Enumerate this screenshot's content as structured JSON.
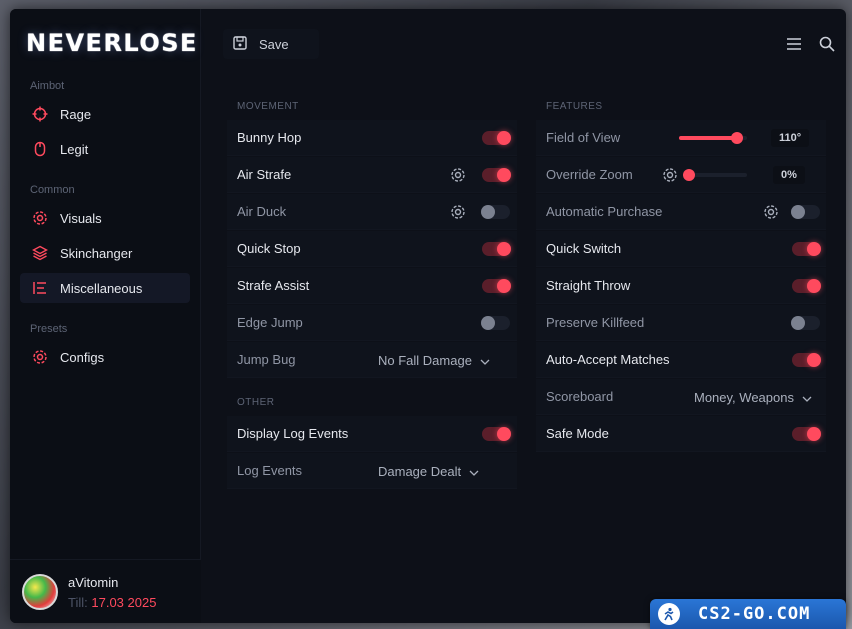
{
  "app": {
    "logo": "NEVERLOSE"
  },
  "sidebar": {
    "sections": [
      {
        "label": "Aimbot",
        "items": [
          {
            "label": "Rage",
            "icon": "crosshair-icon"
          },
          {
            "label": "Legit",
            "icon": "mouse-icon"
          }
        ]
      },
      {
        "label": "Common",
        "items": [
          {
            "label": "Visuals",
            "icon": "gear-icon"
          },
          {
            "label": "Skinchanger",
            "icon": "layers-icon"
          },
          {
            "label": "Miscellaneous",
            "icon": "list-icon"
          }
        ]
      },
      {
        "label": "Presets",
        "items": [
          {
            "label": "Configs",
            "icon": "gear-icon"
          }
        ]
      }
    ],
    "active_item": "Miscellaneous"
  },
  "user": {
    "name": "aVitomin",
    "till_label": "Till:",
    "till_date": "17.03 2025"
  },
  "toolbar": {
    "save_label": "Save"
  },
  "movement": {
    "title": "MOVEMENT",
    "rows": [
      {
        "label": "Bunny Hop",
        "enabled": true
      },
      {
        "label": "Air Strafe",
        "enabled": true,
        "settings": true
      },
      {
        "label": "Air Duck",
        "enabled": false,
        "settings": true
      },
      {
        "label": "Quick Stop",
        "enabled": true
      },
      {
        "label": "Strafe Assist",
        "enabled": true
      },
      {
        "label": "Edge Jump",
        "enabled": false
      },
      {
        "label": "Jump Bug",
        "dropdown": "No Fall Damage"
      }
    ]
  },
  "other": {
    "title": "OTHER",
    "rows": [
      {
        "label": "Display Log Events",
        "enabled": true
      },
      {
        "label": "Log Events",
        "dropdown": "Damage Dealt"
      }
    ]
  },
  "features": {
    "title": "FEATURES",
    "rows": [
      {
        "label": "Field of View",
        "slider": 0.85,
        "value": "110°"
      },
      {
        "label": "Override Zoom",
        "slider": 0.0,
        "value": "0%",
        "settings": true
      },
      {
        "label": "Automatic Purchase",
        "enabled": false,
        "settings": true
      },
      {
        "label": "Quick Switch",
        "enabled": true
      },
      {
        "label": "Straight Throw",
        "enabled": true
      },
      {
        "label": "Preserve Killfeed",
        "enabled": false
      },
      {
        "label": "Auto-Accept Matches",
        "enabled": true
      },
      {
        "label": "Scoreboard",
        "dropdown": "Money, Weapons"
      },
      {
        "label": "Safe Mode",
        "enabled": true
      }
    ]
  },
  "watermark": {
    "text": "CS2-GO.COM"
  },
  "colors": {
    "accent": "#ff4a5e",
    "background": "#0d1018",
    "panel": "#0f131c"
  }
}
